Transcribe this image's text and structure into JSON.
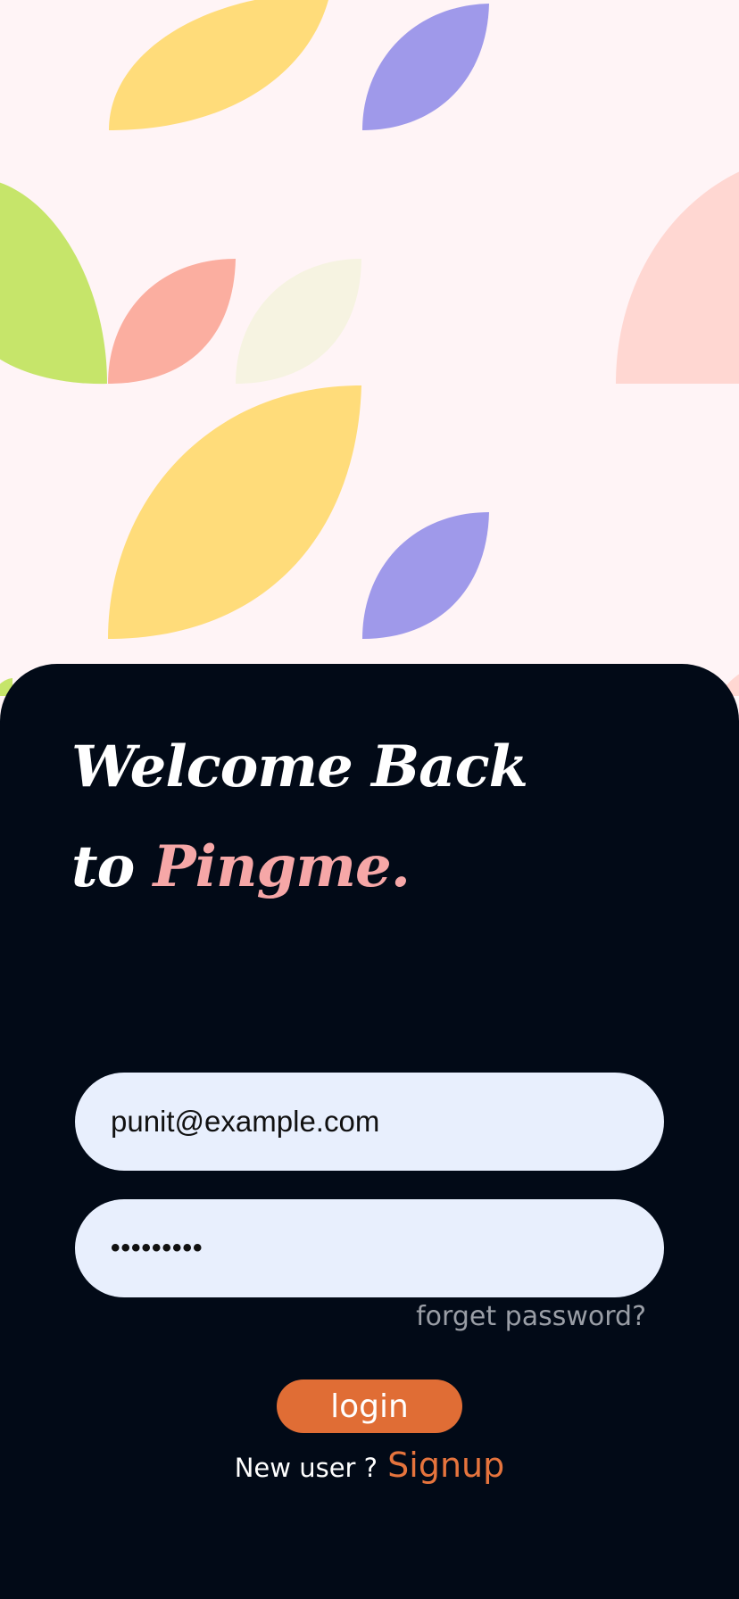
{
  "colors": {
    "page_background": "#fff4f6",
    "card_background": "#020a17",
    "brand_pink": "#f6a7a7",
    "accent_orange": "#e06d35",
    "input_background": "#e8effd",
    "muted_text": "#9a9ea6",
    "petal_yellow": "#ffdc7a",
    "petal_purple": "#9f99ea",
    "petal_green": "#c6e56a",
    "petal_salmon": "#fbaea0",
    "petal_cream": "#f6f3e1",
    "petal_peach": "#ffd7d2"
  },
  "heading": {
    "line1": "Welcome Back",
    "line2_prefix": "to",
    "brand": "Pingme."
  },
  "form": {
    "email_value": "punit@example.com",
    "password_mask": "•••••••••",
    "forget_label": "forget password?",
    "login_label": "login"
  },
  "footer": {
    "new_user_label": "New user ?",
    "signup_label": "Signup"
  }
}
